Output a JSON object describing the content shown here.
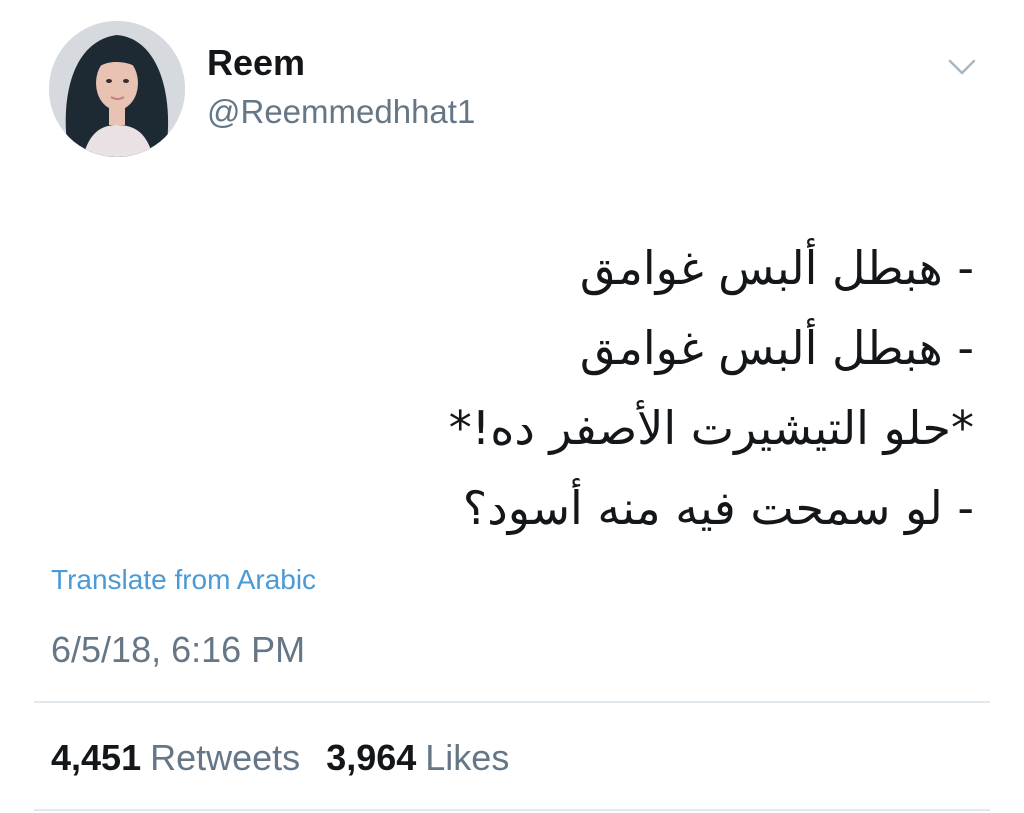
{
  "user": {
    "display_name": "Reem",
    "handle": "@Reemmedhhat1",
    "avatar_icon": "profile-photo"
  },
  "menu": {
    "caret_icon": "chevron-down-icon"
  },
  "tweet": {
    "lines": [
      "- هبطل ألبس غوامق",
      "- هبطل ألبس غوامق",
      "*حلو التيشيرت الأصفر ده!*",
      "- لو سمحت فيه منه أسود؟"
    ],
    "translate_label": "Translate from Arabic",
    "timestamp": "6/5/18, 6:16 PM"
  },
  "stats": {
    "retweets_count": "4,451",
    "retweets_label": "Retweets",
    "likes_count": "3,964",
    "likes_label": "Likes"
  },
  "colors": {
    "text_primary": "#14171a",
    "text_secondary": "#657786",
    "link": "#4a9ad6",
    "divider": "#e1e8ed"
  }
}
